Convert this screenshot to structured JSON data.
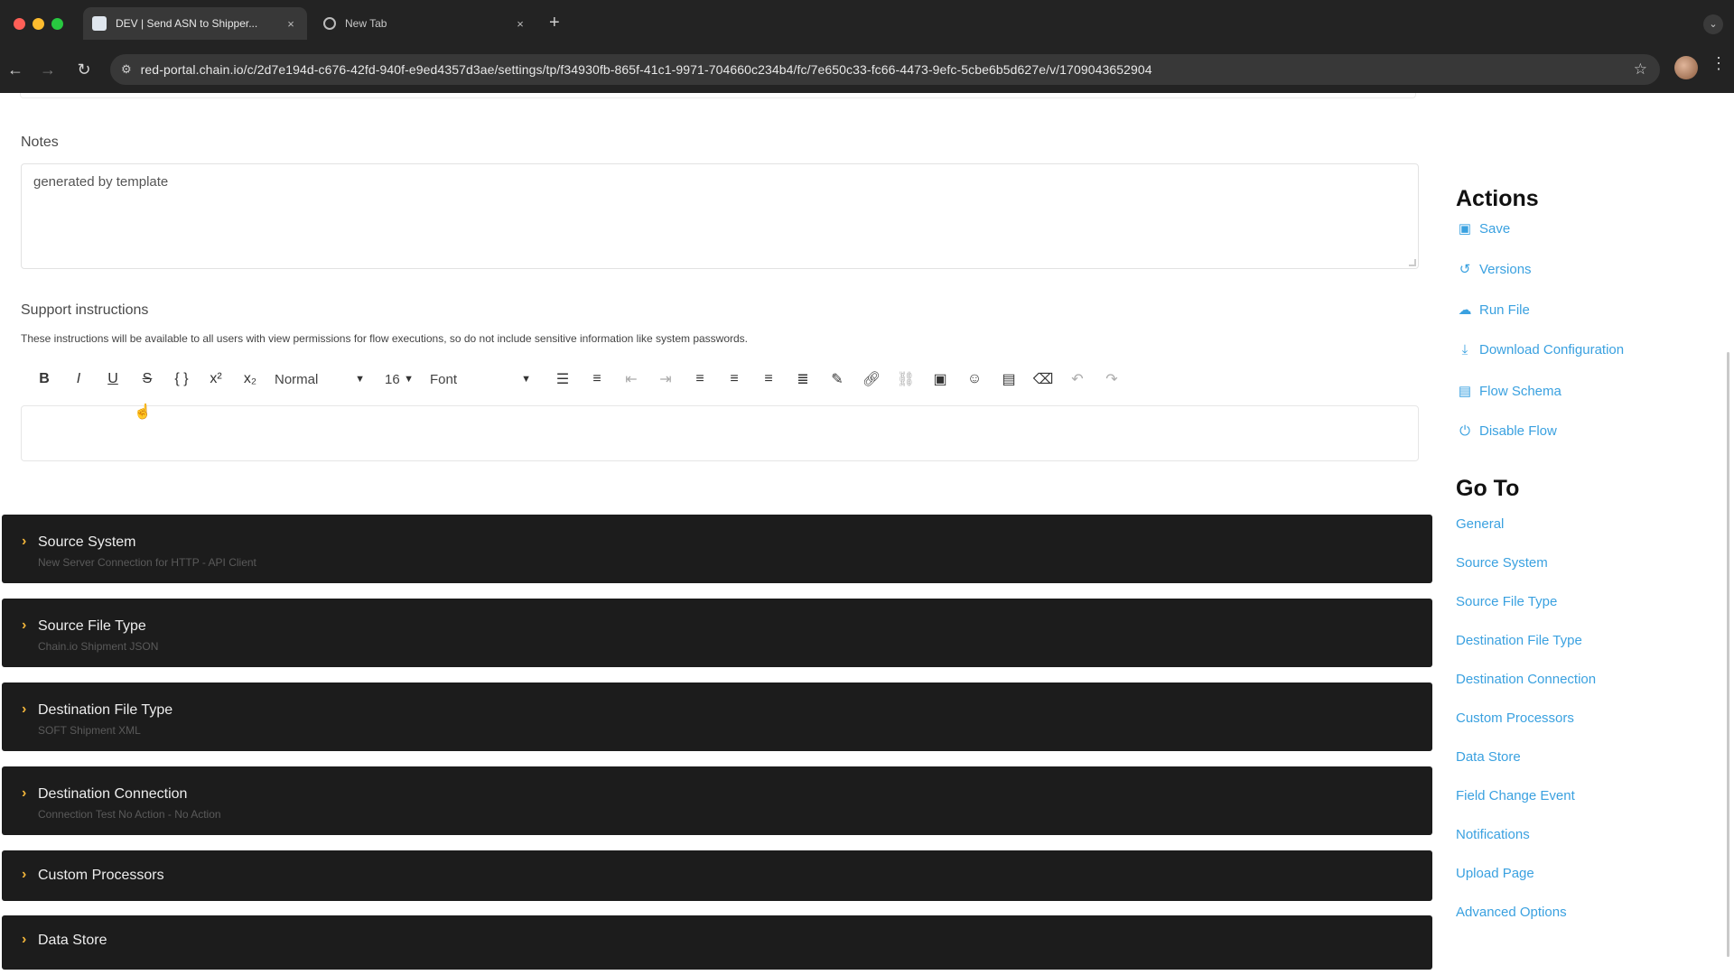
{
  "browser": {
    "tabs": [
      {
        "title": "DEV | Send ASN to Shipper...",
        "close": "×"
      },
      {
        "title": "New Tab",
        "close": "×"
      }
    ],
    "new_tab": "+",
    "url": "red-portal.chain.io/c/2d7e194d-c676-42fd-940f-e9ed4357d3ae/settings/tp/f34930fb-865f-41c1-9971-704660c234b4/fc/7e650c33-fc66-4473-9efc-5cbe6b5d627e/v/1709043652904"
  },
  "notes": {
    "label": "Notes",
    "value": "generated by template"
  },
  "support": {
    "label": "Support instructions",
    "help": "These instructions will be available to all users with view permissions for flow executions, so do not include sensitive information like system passwords.",
    "toolbar": {
      "paragraph_style": "Normal",
      "font_size": "16",
      "font_family": "Font"
    }
  },
  "sections": [
    {
      "title": "Source System",
      "subtitle": "New Server Connection for HTTP - API Client"
    },
    {
      "title": "Source File Type",
      "subtitle": "Chain.io Shipment JSON"
    },
    {
      "title": "Destination File Type",
      "subtitle": "SOFT Shipment XML"
    },
    {
      "title": "Destination Connection",
      "subtitle": "Connection Test No Action - No Action"
    },
    {
      "title": "Custom Processors",
      "subtitle": ""
    },
    {
      "title": "Data Store",
      "subtitle": ""
    }
  ],
  "sidebar": {
    "actions_heading": "Actions",
    "actions": [
      {
        "label": "Save",
        "icon": "save-icon"
      },
      {
        "label": "Versions",
        "icon": "history-icon"
      },
      {
        "label": "Run File",
        "icon": "cloud-upload-icon"
      },
      {
        "label": "Download Configuration",
        "icon": "download-icon"
      },
      {
        "label": "Flow Schema",
        "icon": "file-icon"
      },
      {
        "label": "Disable Flow",
        "icon": "power-icon"
      }
    ],
    "goto_heading": "Go To",
    "goto": [
      "General",
      "Source System",
      "Source File Type",
      "Destination File Type",
      "Destination Connection",
      "Custom Processors",
      "Data Store",
      "Field Change Event",
      "Notifications",
      "Upload Page",
      "Advanced Options"
    ]
  },
  "colors": {
    "link": "#3aa1e0",
    "section_bg": "#1c1c1c",
    "chevron": "#f0b43a",
    "chrome_bg": "#232323"
  }
}
